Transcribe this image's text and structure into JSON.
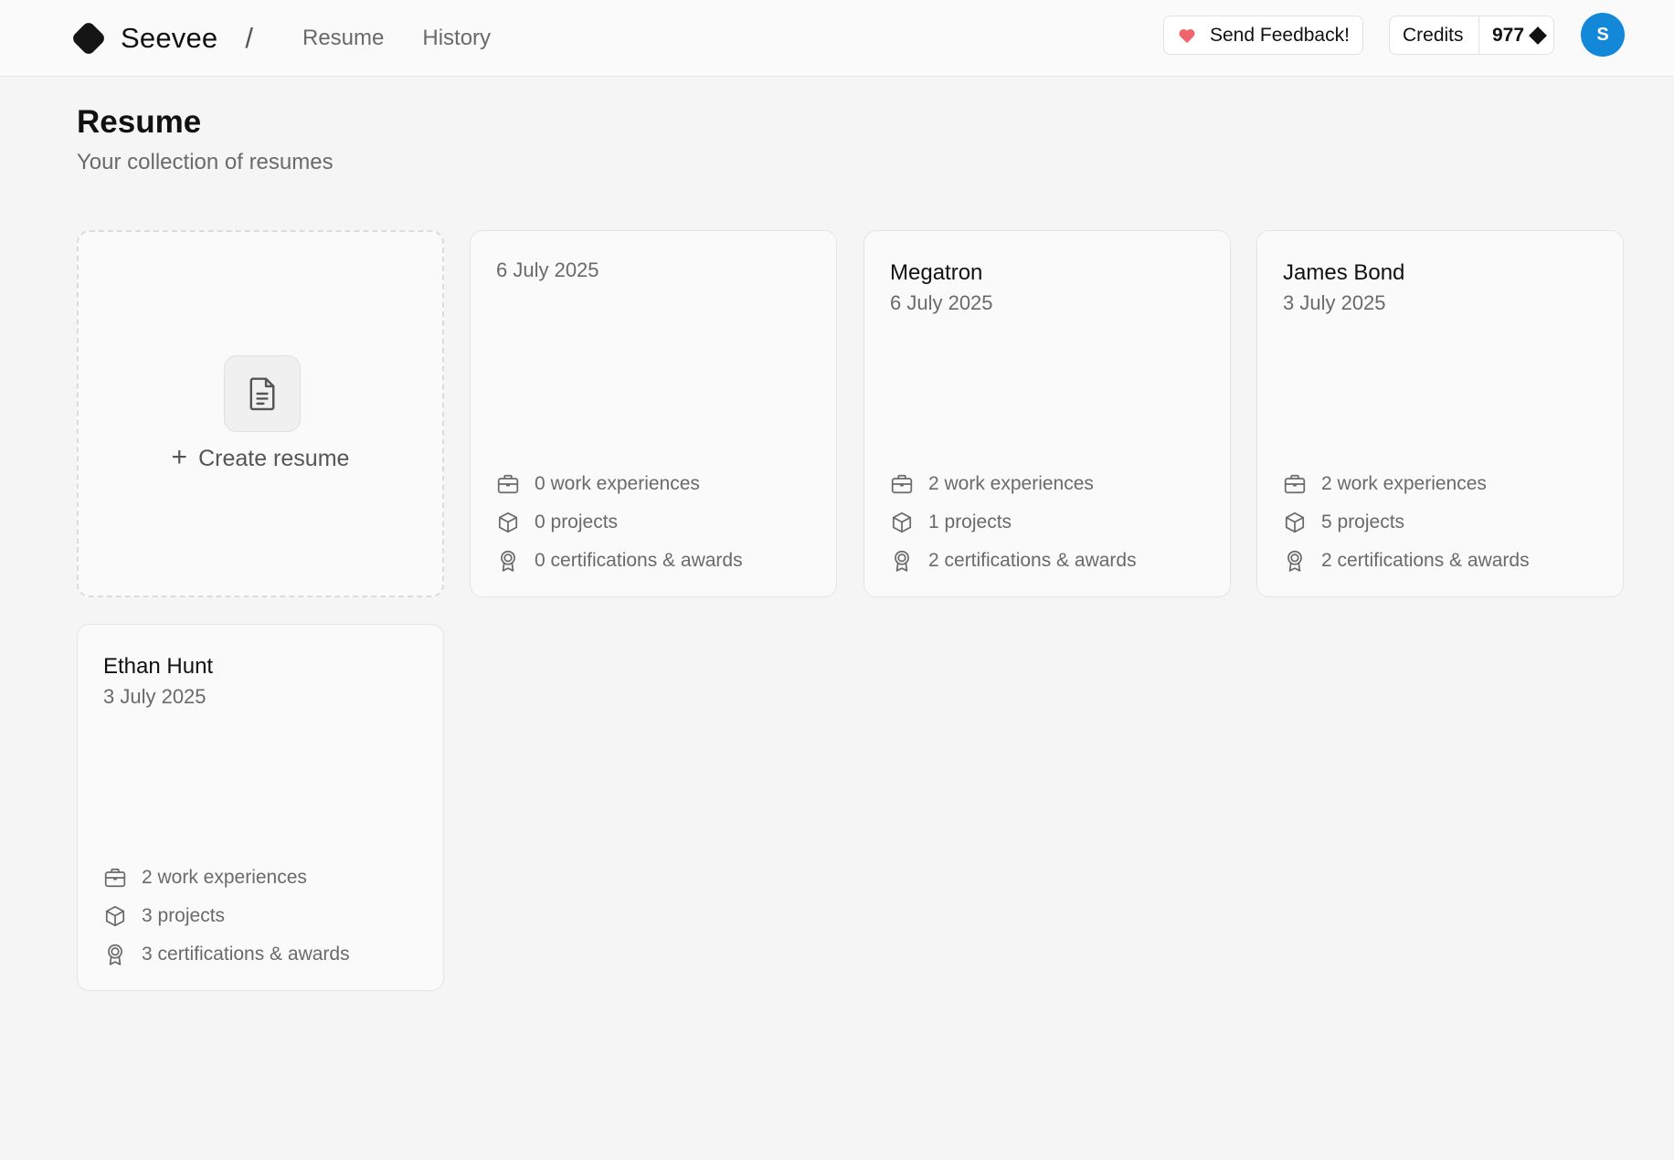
{
  "header": {
    "brand": "Seevee",
    "separator": "/",
    "nav": [
      "Resume",
      "History"
    ],
    "feedback_label": "Send Feedback!",
    "credits_label": "Credits",
    "credits_value": "977",
    "avatar_initial": "S",
    "accent_color": "#1488d8",
    "heart_color": "#f0646c"
  },
  "page": {
    "title": "Resume",
    "subtitle": "Your collection of resumes"
  },
  "create_card": {
    "label": "Create resume",
    "icon": "document-icon"
  },
  "resumes": [
    {
      "name": "",
      "date": "6 July 2025",
      "work": "0 work experiences",
      "projects": "0 projects",
      "certs": "0 certifications & awards"
    },
    {
      "name": "Megatron",
      "date": "6 July 2025",
      "work": "2 work experiences",
      "projects": "1 projects",
      "certs": "2 certifications & awards"
    },
    {
      "name": "James Bond",
      "date": "3 July 2025",
      "work": "2 work experiences",
      "projects": "5 projects",
      "certs": "2 certifications & awards"
    },
    {
      "name": "Ethan Hunt",
      "date": "3 July 2025",
      "work": "2 work experiences",
      "projects": "3 projects",
      "certs": "3 certifications & awards"
    }
  ]
}
